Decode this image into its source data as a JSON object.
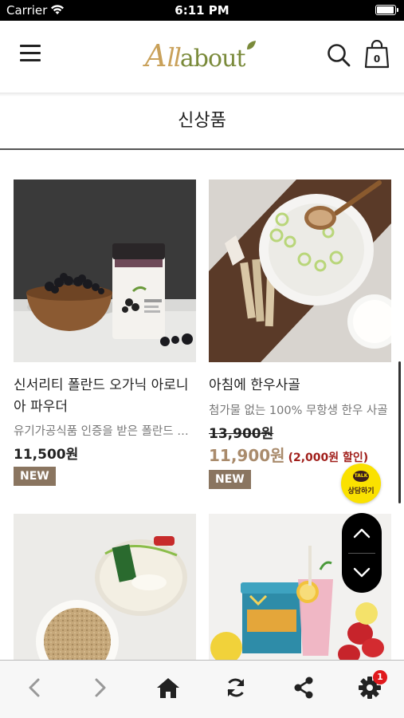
{
  "status_bar": {
    "carrier": "Carrier",
    "time": "6:11 PM",
    "battery_level": 0.95
  },
  "header": {
    "logo": "Allabout",
    "cart_count": "0"
  },
  "page_title": "신상품",
  "products": [
    {
      "name": "신서리티 폴란드 오가닉 아로니아 파우더",
      "description": "유기가공식품 인증을 받은 폴란드 오가닉 아로니아",
      "price": "11,500원",
      "badge": "NEW",
      "image": "aronia-powder-jar"
    },
    {
      "name": "아침에 한우사골",
      "description": "첨가물 없는 100% 무항생 한우 사골",
      "original_price": "13,900원",
      "sale_price": "11,900원",
      "discount": "(2,000원 할인)",
      "badge": "NEW",
      "image": "beef-bone-broth-bowl"
    },
    {
      "name": "",
      "image": "instant-rice-container"
    },
    {
      "name": "",
      "image": "raw-pink-drink"
    }
  ],
  "floating": {
    "chat_badge": "TALK",
    "chat_label": "상담하기"
  },
  "toolbar": {
    "items": [
      "back-icon",
      "forward-icon",
      "home-icon",
      "refresh-icon",
      "share-icon",
      "settings-icon"
    ],
    "settings_badge": "1"
  },
  "colors": {
    "brand_gold": "#c9a15a",
    "brand_green": "#7a8a3a",
    "sale_price": "#a98b6c",
    "discount_red": "#a1201c",
    "badge_new": "#8a7560",
    "kakao_yellow": "#fae100"
  }
}
